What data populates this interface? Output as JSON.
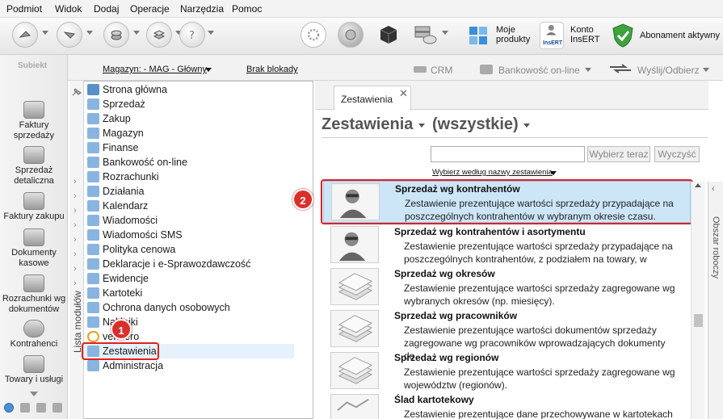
{
  "menu": [
    "Podmiot",
    "Widok",
    "Dodaj",
    "Operacje",
    "Narzędzia",
    "Pomoc"
  ],
  "toolbar": {
    "moje_produkty": "Moje\nprodukty",
    "konto": "Konto\nInsERT",
    "abonament": "Abonament aktywny",
    "insert_logo": "InsERT"
  },
  "leftnav": {
    "brand": "Subiekt",
    "items": [
      "Faktury\nsprzedaży",
      "Sprzedaż\ndetaliczna",
      "Faktury zakupu",
      "Dokumenty\nkasowe",
      "Rozrachunki wg\ndokumentów",
      "Kontrahenci",
      "Towary i usługi"
    ]
  },
  "subbar": {
    "magazyn": "Magazyn: - MAG - Główny",
    "blokady": "Brak blokady",
    "crm": "CRM",
    "bankowosc": "Bankowość on-line",
    "wyslij": "Wyślij/Odbierz"
  },
  "modules": {
    "vertical_label": "Lista modułów",
    "items": [
      "Strona główna",
      "Sprzedaż",
      "Zakup",
      "Magazyn",
      "Finanse",
      "Bankowość on-line",
      "Rozrachunki",
      "Działania",
      "Kalendarz",
      "Wiadomości",
      "Wiadomości SMS",
      "Polityka cenowa",
      "Deklaracje i e-Sprawozdawczość",
      "Ewidencje",
      "Kartoteki",
      "Ochrona danych osobowych",
      "Naklejki",
      "vendero",
      "Zestawienia",
      "Administracja"
    ]
  },
  "right": {
    "tab": "Zestawienia",
    "title": "Zestawienia",
    "filter": "(wszystkie)",
    "search_value": "",
    "btn_select": "Wybierz teraz",
    "btn_clear": "Wyczyść",
    "sort_label": "Wybierz według nazwy zestawienia",
    "side_label": "Obszar roboczy",
    "entries": [
      {
        "title": "Sprzedaż wg kontrahentów",
        "desc": "Zestawienie prezentujące wartości sprzedaży przypadające na poszczególnych kontrahentów w wybranym okresie czasu."
      },
      {
        "title": "Sprzedaż wg kontrahentów i asortymentu",
        "desc": "Zestawienie prezentujące wartości sprzedaży przypadające na poszczególnych kontrahentów, z podziałem na towary, w"
      },
      {
        "title": "Sprzedaż wg okresów",
        "desc": "Zestawienie prezentujące wartości sprzedaży zagregowane wg wybranych okresów (np. miesięcy)."
      },
      {
        "title": "Sprzedaż wg pracowników",
        "desc": "Zestawienie prezentujące wartości dokumentów sprzedaży zagregowane wg pracowników wprowadzających dokumenty do"
      },
      {
        "title": "Sprzedaż wg regionów",
        "desc": "Zestawienie prezentujące wartości sprzedaży zagregowane wg województw (regionów)."
      },
      {
        "title": "Ślad kartotekowy",
        "desc": "Zestawienie prezentujące dane przechowywane w kartotekach"
      }
    ]
  },
  "badges": {
    "one": "1",
    "two": "2"
  },
  "colors": {
    "accent": "#cde6f7",
    "highlight_border": "#e02020",
    "badge": "#d9302c"
  }
}
